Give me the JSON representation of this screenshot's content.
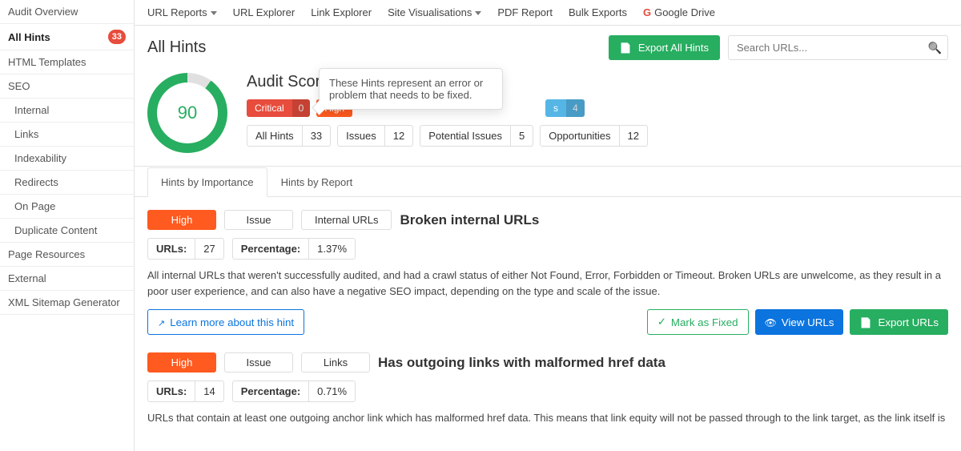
{
  "sidebar": {
    "items": [
      {
        "label": "Audit Overview"
      },
      {
        "label": "All Hints",
        "badge": "33",
        "active": true
      },
      {
        "label": "HTML Templates"
      },
      {
        "label": "SEO"
      },
      {
        "label": "Internal",
        "sub": true
      },
      {
        "label": "Links",
        "sub": true
      },
      {
        "label": "Indexability",
        "sub": true
      },
      {
        "label": "Redirects",
        "sub": true
      },
      {
        "label": "On Page",
        "sub": true
      },
      {
        "label": "Duplicate Content",
        "sub": true
      },
      {
        "label": "Page Resources"
      },
      {
        "label": "External"
      },
      {
        "label": "XML Sitemap Generator"
      }
    ]
  },
  "topnav": {
    "items": [
      {
        "label": "URL Reports",
        "caret": true
      },
      {
        "label": "URL Explorer"
      },
      {
        "label": "Link Explorer"
      },
      {
        "label": "Site Visualisations",
        "caret": true
      },
      {
        "label": "PDF Report"
      },
      {
        "label": "Bulk Exports"
      }
    ],
    "gdrive": {
      "prefix": "G",
      "label": "Google Drive"
    }
  },
  "titlebar": {
    "title": "All Hints",
    "export_label": "Export All Hints",
    "search_placeholder": "Search URLs..."
  },
  "audit": {
    "score": "90",
    "heading": "Audit Score",
    "severity": [
      {
        "label": "Critical",
        "count": "0",
        "color": "red"
      },
      {
        "label": "High",
        "count": "",
        "color": "orange"
      },
      {
        "label": "s",
        "count": "4",
        "color": "lblue"
      }
    ],
    "filters": [
      {
        "label": "All Hints",
        "count": "33"
      },
      {
        "label": "Issues",
        "count": "12"
      },
      {
        "label": "Potential Issues",
        "count": "5"
      },
      {
        "label": "Opportunities",
        "count": "12"
      }
    ],
    "tooltip": "These Hints represent an error or problem that needs to be fixed."
  },
  "tabs": {
    "importance": "Hints by Importance",
    "report": "Hints by Report"
  },
  "hints": [
    {
      "severity": "High",
      "type": "Issue",
      "report": "Internal URLs",
      "title": "Broken internal URLs",
      "urls_label": "URLs:",
      "urls_value": "27",
      "pct_label": "Percentage:",
      "pct_value": "1.37%",
      "desc": "All internal URLs that weren't successfully audited, and had a crawl status of either Not Found, Error, Forbidden or Timeout. Broken URLs are unwelcome, as they result in a poor user experience, and can also have a negative SEO impact, depending on the type and scale of the issue.",
      "learn": "Learn more about this hint",
      "mark_fixed": "Mark as Fixed",
      "view_urls": "View URLs",
      "export_urls": "Export URLs"
    },
    {
      "severity": "High",
      "type": "Issue",
      "report": "Links",
      "title": "Has outgoing links with malformed href data",
      "urls_label": "URLs:",
      "urls_value": "14",
      "pct_label": "Percentage:",
      "pct_value": "0.71%",
      "desc": "URLs that contain at least one outgoing anchor link which has malformed href data. This means that link equity will not be passed through to the link target, as the link itself is"
    }
  ]
}
